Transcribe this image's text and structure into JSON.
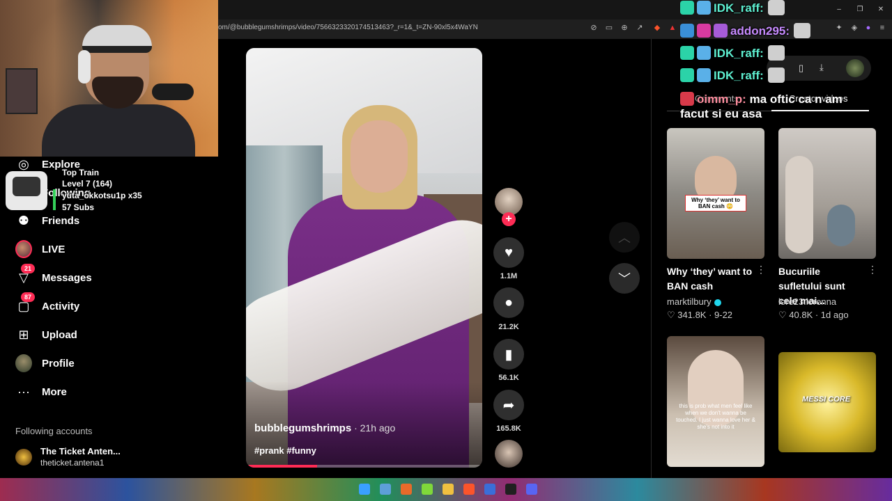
{
  "browser": {
    "url": "om/@bubblegumshrimps/video/7566323320174513463?_r=1&_t=ZN-90xl5x4WaYN",
    "win_minimize": "–",
    "win_restore": "❐",
    "win_close": "✕"
  },
  "overlay": {
    "train_title": "Top Train",
    "train_level": "Level 7  (164)",
    "train_user": "yuta_okkotsu1p x35",
    "train_subs": "57 Subs"
  },
  "sidebar": {
    "items": [
      {
        "label": "Explore",
        "icon": "compass-icon"
      },
      {
        "label": "Following",
        "icon": "following-icon"
      },
      {
        "label": "Friends",
        "icon": "friends-icon"
      },
      {
        "label": "LIVE",
        "icon": "live-icon"
      },
      {
        "label": "Messages",
        "icon": "messages-icon",
        "badge": "21"
      },
      {
        "label": "Activity",
        "icon": "activity-icon",
        "badge": "87"
      },
      {
        "label": "Upload",
        "icon": "upload-icon"
      },
      {
        "label": "Profile",
        "icon": "profile-icon"
      },
      {
        "label": "More",
        "icon": "more-icon"
      }
    ],
    "following_heading": "Following accounts",
    "following_account_name": "The Ticket Anten...",
    "following_account_handle": "theticket.antena1"
  },
  "video": {
    "author": "bubblegumshrimps",
    "time": " · 21h ago",
    "tags": "#prank #funny",
    "progress_fraction": 0.3
  },
  "actions": {
    "likes": "1.1M",
    "comments": "21.2K",
    "saves": "56.1K",
    "shares": "165.8K",
    "follow_symbol": "+"
  },
  "right_panel": {
    "tab_comments": "Comments",
    "tab_creator": "Creator videos",
    "cards": [
      {
        "title": "Why ‘they’ want to BAN cash",
        "author": "marktilbury",
        "verified": true,
        "stats": "♡ 341.8K · 9-22",
        "thumb_text": "Why ‘they’ want to BAN cash 😳"
      },
      {
        "title": "Bucuriile sufletului sunt cele mai...",
        "author": "lore23.lorenna",
        "verified": false,
        "stats": "♡ 40.8K · 1d ago",
        "thumb_text": ""
      },
      {
        "title": "",
        "author": "",
        "verified": false,
        "stats": "",
        "thumb_text": "this is prob what men feel like when we don't wanna be touched. I just wanna love her & she's not into it"
      },
      {
        "title": "",
        "author": "",
        "verified": false,
        "stats": "",
        "thumb_text": "MESSI CORE"
      }
    ]
  },
  "chat": [
    {
      "user": "IDK_raff:",
      "message": "",
      "color": "#5ef0d1"
    },
    {
      "user": "addon295:",
      "message": "",
      "color": "#c78bff"
    },
    {
      "user": "IDK_raff:",
      "message": "",
      "color": "#5ef0d1"
    },
    {
      "user": "IDK_raff:",
      "message": "",
      "color": "#5ef0d1"
    },
    {
      "user": "oimm_p:",
      "message": "ma oftic ca n am",
      "color": "#ff8fa0"
    },
    {
      "user": "",
      "message": "facut si eu asa",
      "color": "#ffffff"
    }
  ],
  "colors": {
    "accent": "#fe2c55",
    "verified": "#20d5ec",
    "background": "#000000"
  }
}
